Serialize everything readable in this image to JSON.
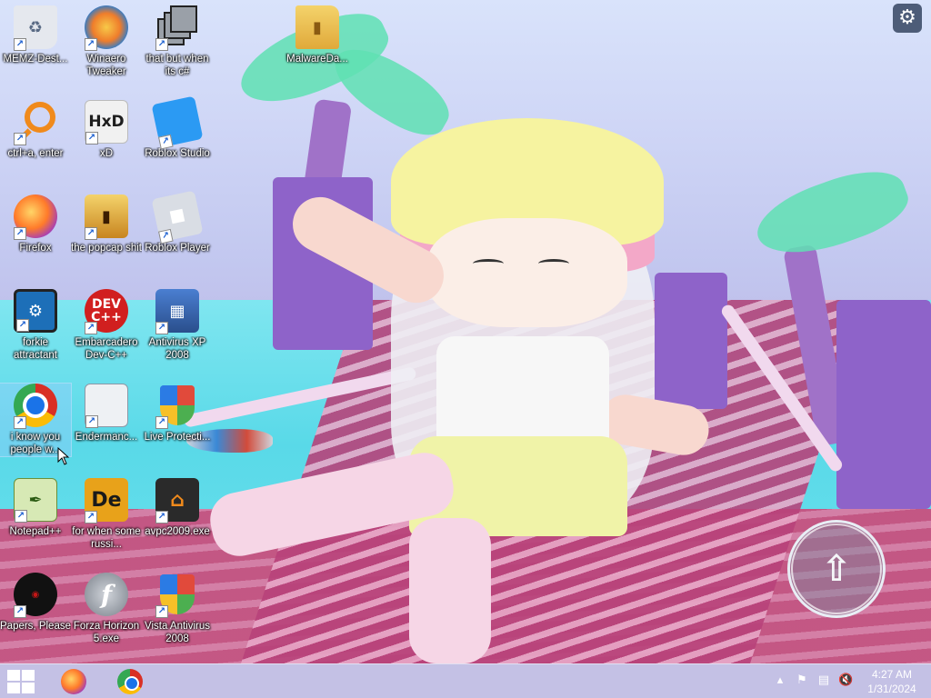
{
  "desktop": {
    "icons": [
      {
        "label": "MEMZ-Dest...",
        "icon": "recycle-bin-icon"
      },
      {
        "label": "Winaero Tweaker",
        "icon": "winaero-icon"
      },
      {
        "label": "that but when its c#",
        "icon": "stacked-windows-icon"
      },
      {
        "label": "MalwareDa...",
        "icon": "folder-icon"
      },
      {
        "label": "ctrl+a, enter",
        "icon": "magnifier-icon"
      },
      {
        "label": "xD",
        "icon": "hxd-icon",
        "glyph": "HxD"
      },
      {
        "label": "Roblox Studio",
        "icon": "roblox-studio-icon"
      },
      {
        "label": "Firefox",
        "icon": "firefox-icon"
      },
      {
        "label": "the popcap shit",
        "icon": "folder-icon"
      },
      {
        "label": "Roblox Player",
        "icon": "roblox-player-icon"
      },
      {
        "label": "forkie attractant",
        "icon": "monitor-gear-icon"
      },
      {
        "label": "Embarcadero Dev-C++",
        "icon": "devcpp-icon",
        "glyph": "DEV C++"
      },
      {
        "label": "Antivirus XP 2008",
        "icon": "antivirus-xp-icon"
      },
      {
        "label": "i know you people w...",
        "icon": "chrome-icon"
      },
      {
        "label": "Endermanc...",
        "icon": "window-icon"
      },
      {
        "label": "Live Protecti...",
        "icon": "shield-icon"
      },
      {
        "label": "Notepad++",
        "icon": "notepadpp-icon"
      },
      {
        "label": "for when some russi...",
        "icon": "de-icon",
        "glyph": "De"
      },
      {
        "label": "avpc2009.exe",
        "icon": "avpc-icon"
      },
      {
        "label": "Papers, Please",
        "icon": "papers-please-icon"
      },
      {
        "label": "Forza Horizon 5.exe",
        "icon": "flash-icon",
        "glyph": "f"
      },
      {
        "label": "Vista Antivirus 2008",
        "icon": "shield-icon"
      }
    ]
  },
  "taskbar": {
    "pinned": [
      {
        "name": "Firefox",
        "icon": "firefox-icon"
      },
      {
        "name": "Google Chrome",
        "icon": "chrome-icon"
      }
    ],
    "clock": {
      "time": "4:27 AM",
      "date": "1/31/2024"
    }
  },
  "overlay": {
    "settings_icon": "gear-icon",
    "jump_icon": "up-arrow-icon"
  },
  "colors": {
    "taskbar": "#c8d6ec",
    "folder": "#f4d36b"
  }
}
